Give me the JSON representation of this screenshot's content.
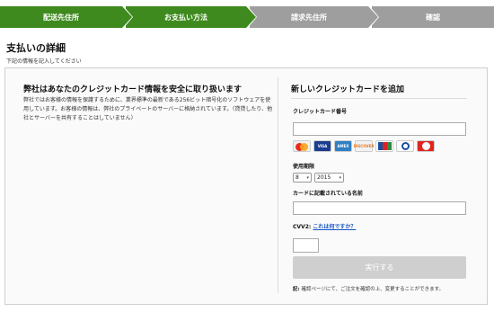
{
  "steps": [
    {
      "label": "配送先住所",
      "state": "active"
    },
    {
      "label": "お支払い方法",
      "state": "active"
    },
    {
      "label": "請求先住所",
      "state": "inactive"
    },
    {
      "label": "確認",
      "state": "inactive"
    }
  ],
  "page": {
    "title": "支払いの詳細",
    "subtitle": "下記の情報を記入してください"
  },
  "security": {
    "heading": "弊社はあなたのクレジットカード情報を安全に取り扱います",
    "body": "弊社ではお客様の情報を保護するために、業界標準の最新である256ビット暗号化のソフトウェアを使用しています。お客様の情報は、弊社のプライベートのサーバーに格納されています。（貸貸したり、他社とサーバーを共有することはしていません）"
  },
  "card_form": {
    "heading": "新しいクレジットカードを追加",
    "card_number_label": "クレジットカード番号",
    "card_number_value": "",
    "brands": [
      "mastercard-icon",
      "visa-icon",
      "amex-icon",
      "discover-icon",
      "jcb-icon",
      "diners-icon",
      "ginren-icon"
    ],
    "brand_text": {
      "visa": "VISA",
      "amex": "AMEX",
      "discover": "DISCOVER"
    },
    "expiry_label": "使用期限",
    "expiry_month": "8",
    "expiry_year": "2015",
    "name_label": "カードに記載されている名前",
    "name_value": "",
    "cvv_label": "CVV2:",
    "cvv_link": "これは何ですか？",
    "cvv_value": "",
    "submit_label": "実行する",
    "note_prefix": "記:",
    "note_text": "確認ページにて、ご注文を確認の上、変更することができます。"
  },
  "colors": {
    "active_step": "#3e8a1e",
    "inactive_step": "#9e9e9e",
    "link": "#1a56c6"
  }
}
